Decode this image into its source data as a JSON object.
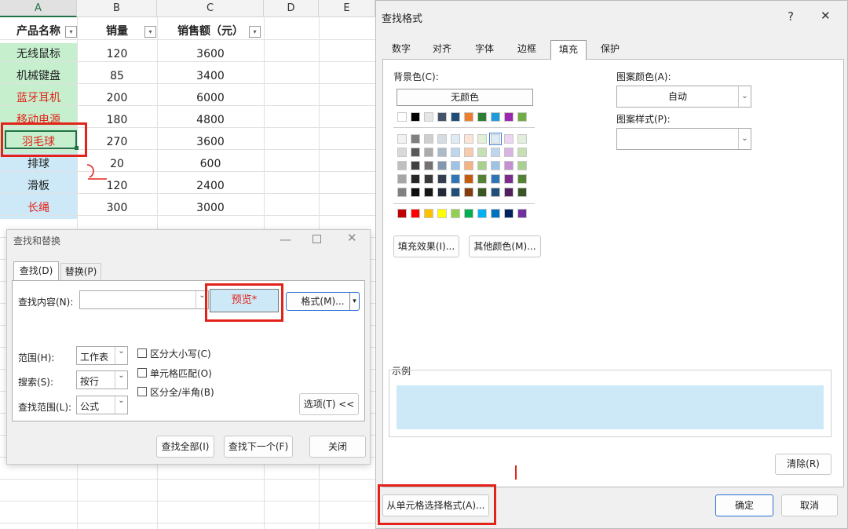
{
  "sheet": {
    "col_headers": [
      "A",
      "B",
      "C",
      "D",
      "E"
    ],
    "header_row": {
      "name": "产品名称",
      "qty": "销量",
      "sales": "销售额（元）"
    },
    "rows": [
      {
        "name": "无线鼠标",
        "qty": "120",
        "sales": "3600",
        "bg": "#c6efce",
        "color": "#222222"
      },
      {
        "name": "机械键盘",
        "qty": "85",
        "sales": "3400",
        "bg": "#c6efce",
        "color": "#222222"
      },
      {
        "name": "蓝牙耳机",
        "qty": "200",
        "sales": "6000",
        "bg": "#c6efce",
        "color": "#e2231a"
      },
      {
        "name": "移动电源",
        "qty": "180",
        "sales": "4800",
        "bg": "#c6efce",
        "color": "#e2231a"
      },
      {
        "name": "羽毛球",
        "qty": "270",
        "sales": "3600",
        "bg": "#c6efce",
        "color": "#e2231a"
      },
      {
        "name": "排球",
        "qty": "20",
        "sales": "600",
        "bg": "#cde9f7",
        "color": "#222222"
      },
      {
        "name": "滑板",
        "qty": "120",
        "sales": "2400",
        "bg": "#cde9f7",
        "color": "#222222"
      },
      {
        "name": "长绳",
        "qty": "300",
        "sales": "3000",
        "bg": "#cde9f7",
        "color": "#e2231a"
      }
    ],
    "filter_arrow": "▾"
  },
  "find_replace": {
    "title": "查找和替换",
    "tabs": [
      "查找(D)",
      "替换(P)"
    ],
    "find_label": "查找内容(N):",
    "find_value": "",
    "preview_label": "预览*",
    "format_label": "格式(M)...",
    "scope_label": "范围(H):",
    "scope_value": "工作表",
    "search_label": "搜索(S):",
    "search_value": "按行",
    "lookin_label": "查找范围(L):",
    "lookin_value": "公式",
    "checks": [
      "区分大小写(C)",
      "单元格匹配(O)",
      "区分全/半角(B)"
    ],
    "options_label": "选项(T) <<",
    "find_all": "查找全部(I)",
    "find_next": "查找下一个(F)",
    "close": "关闭"
  },
  "find_format": {
    "title": "查找格式",
    "help": "?",
    "close": "✕",
    "tabs": [
      "数字",
      "对齐",
      "字体",
      "边框",
      "填充",
      "保护"
    ],
    "active_tab": 4,
    "bg_color_label": "背景色(C):",
    "no_color": "无颜色",
    "pattern_color_label": "图案颜色(A):",
    "pattern_color_value": "自动",
    "pattern_style_label": "图案样式(P):",
    "pattern_style_value": "",
    "fill_effects": "填充效果(I)...",
    "more_colors": "其他颜色(M)...",
    "sample_label": "示例",
    "sample_color": "#cde9f7",
    "clear": "清除(R)",
    "choose_from_cell": "从单元格选择格式(A)...",
    "ok": "确定",
    "cancel": "取消",
    "theme_row": [
      "#ffffff",
      "#000000",
      "#e7e6e6",
      "#44546a",
      "#1f4e79",
      "#ed7d31",
      "#2e7d32",
      "#1f9bd7",
      "#9c27b0",
      "#70ad47"
    ],
    "tint_rows": [
      [
        "#f2f2f2",
        "#7f7f7f",
        "#d0cece",
        "#d6dce4",
        "#deebf7",
        "#fbe5d6",
        "#e2f0d9",
        "#ddebf7",
        "#ecd5f0",
        "#e2efda"
      ],
      [
        "#d9d9d9",
        "#595959",
        "#aeaaaa",
        "#adb9ca",
        "#bdd7ee",
        "#f8cbad",
        "#c5e0b4",
        "#bdd7ee",
        "#d9b3e2",
        "#c6e0b4"
      ],
      [
        "#bfbfbf",
        "#404040",
        "#757171",
        "#8497b0",
        "#9dc3e6",
        "#f4b183",
        "#a9d18e",
        "#9dc3e6",
        "#c58fd4",
        "#a9d08e"
      ],
      [
        "#a6a6a6",
        "#262626",
        "#3a3838",
        "#333f50",
        "#2e75b6",
        "#c55a11",
        "#548235",
        "#2e75b6",
        "#7b2c8c",
        "#548235"
      ],
      [
        "#808080",
        "#0d0d0d",
        "#171616",
        "#222a35",
        "#1f4e79",
        "#833c0b",
        "#385723",
        "#1f4e79",
        "#52205e",
        "#375623"
      ]
    ],
    "standard_row": [
      "#c00000",
      "#ff0000",
      "#ffc000",
      "#ffff00",
      "#92d050",
      "#00b050",
      "#00b0f0",
      "#0070c0",
      "#002060",
      "#7030a0"
    ]
  }
}
